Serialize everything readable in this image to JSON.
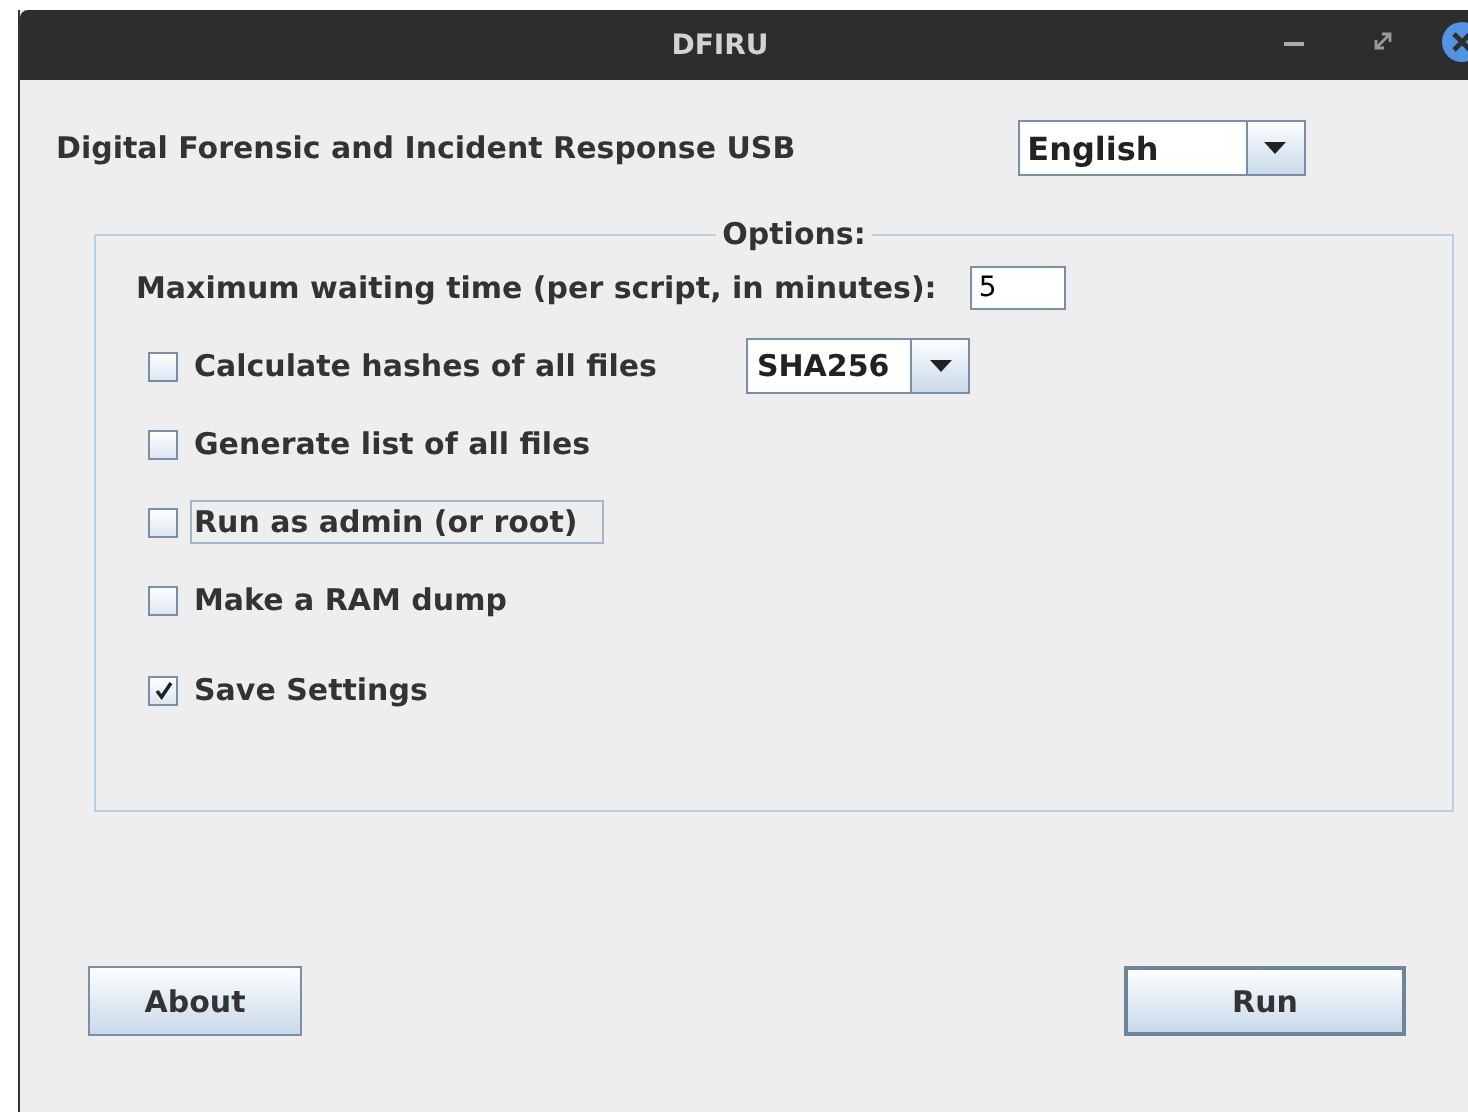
{
  "window": {
    "title": "DFIRU"
  },
  "header": {
    "label": "Digital Forensic and Incident Response USB",
    "language": "English"
  },
  "options": {
    "title": "Options:",
    "wait_label": "Maximum waiting time (per script, in minutes):",
    "wait_value": "5",
    "items": [
      {
        "kind": "hash",
        "label": "Calculate hashes of all files",
        "checked": false,
        "focused": false,
        "algorithm": "SHA256"
      },
      {
        "kind": "check",
        "label": "Generate list of all files",
        "checked": false,
        "focused": false
      },
      {
        "kind": "check",
        "label": "Run as admin (or root)",
        "checked": false,
        "focused": true
      },
      {
        "kind": "check",
        "label": "Make a RAM dump",
        "checked": false,
        "focused": false
      },
      {
        "kind": "check",
        "label": "Save Settings",
        "checked": true,
        "focused": false
      }
    ]
  },
  "buttons": [
    {
      "label": "About",
      "default": false
    },
    {
      "label": "Run",
      "default": true
    }
  ]
}
